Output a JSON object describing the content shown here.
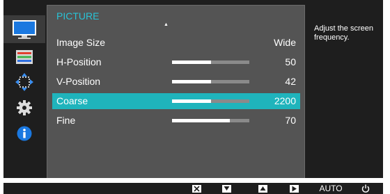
{
  "menu": {
    "title": "PICTURE",
    "items": [
      {
        "label": "Image Size",
        "value": "Wide",
        "bar": null,
        "selected": false
      },
      {
        "label": "H-Position",
        "value": "50",
        "bar": 0.5,
        "selected": false
      },
      {
        "label": "V-Position",
        "value": "42",
        "bar": 0.5,
        "selected": false
      },
      {
        "label": "Coarse",
        "value": "2200",
        "bar": 0.5,
        "selected": true
      },
      {
        "label": "Fine",
        "value": "70",
        "bar": 0.75,
        "selected": false
      }
    ]
  },
  "help": {
    "text": "Adjust the screen frequency."
  },
  "sidebar": {
    "icons": [
      "monitor-icon",
      "picture-settings-icon",
      "position-arrows-icon",
      "gear-icon",
      "info-icon"
    ],
    "selected_index": 0
  },
  "buttons": {
    "close": "close-icon",
    "down": "down-triangle-icon",
    "up": "up-triangle-icon",
    "enter": "right-triangle-icon",
    "auto_label": "AUTO",
    "power": "power-icon"
  },
  "colors": {
    "accent": "#29c3d6",
    "selected_row": "#1fb4bc",
    "panel": "#545454",
    "background": "#1e1e1e"
  }
}
